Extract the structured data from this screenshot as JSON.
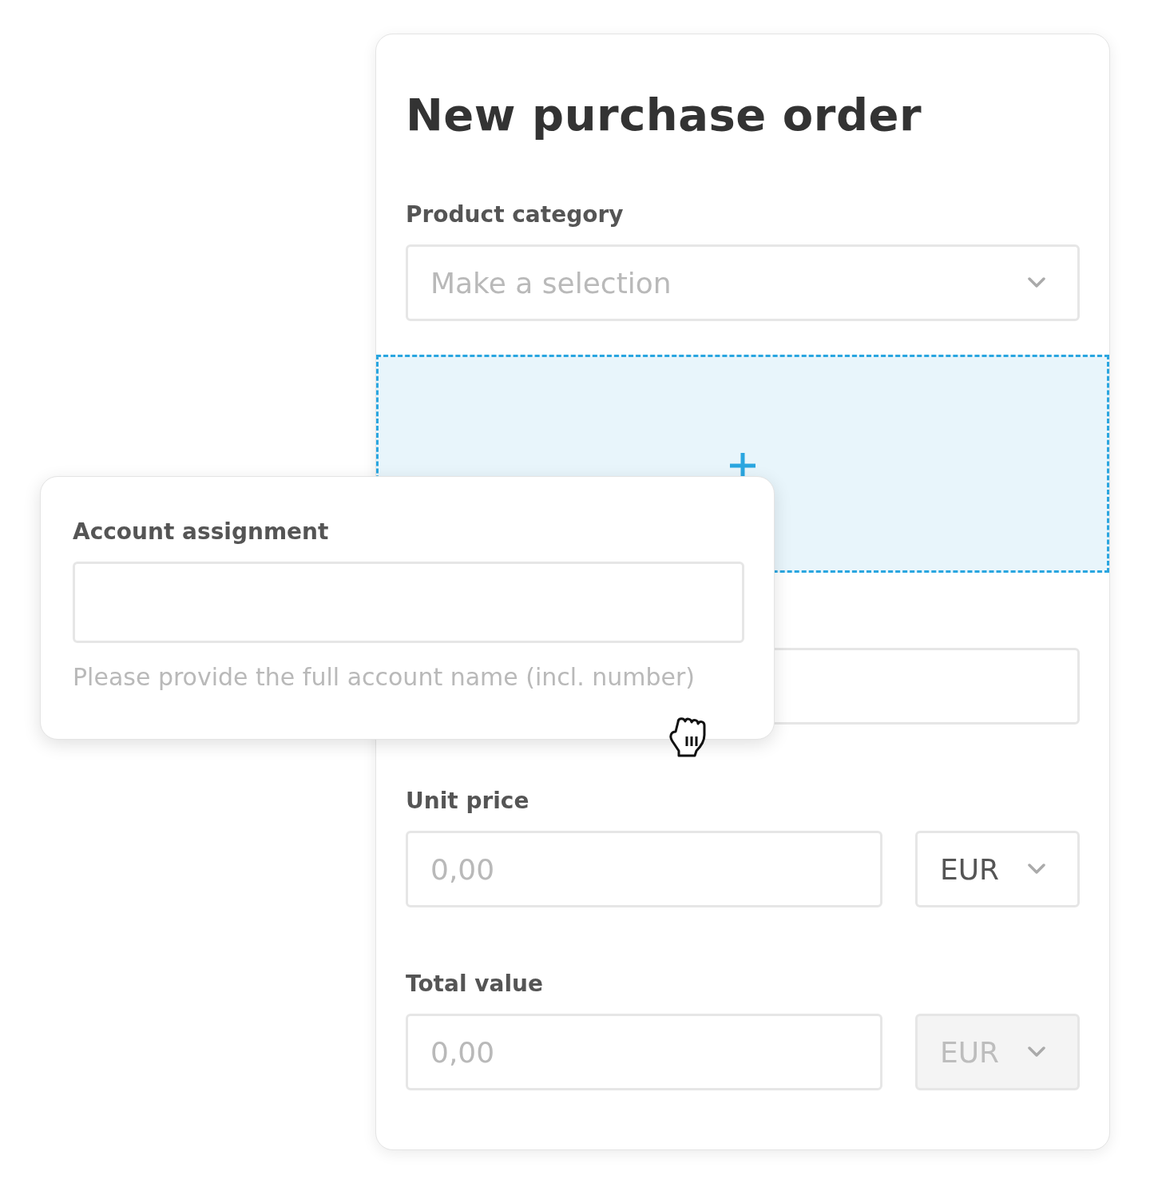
{
  "title": "New purchase order",
  "product_category": {
    "label": "Product category",
    "placeholder": "Make a selection"
  },
  "unit_price": {
    "label": "Unit price",
    "placeholder": "0,00",
    "currency": {
      "value": "EUR",
      "disabled": false
    }
  },
  "total_value": {
    "label": "Total value",
    "placeholder": "0,00",
    "currency": {
      "value": "EUR",
      "disabled": true
    }
  },
  "dragged_field": {
    "label": "Account assignment",
    "helper_text": "Please provide the full account name (incl. number)"
  }
}
